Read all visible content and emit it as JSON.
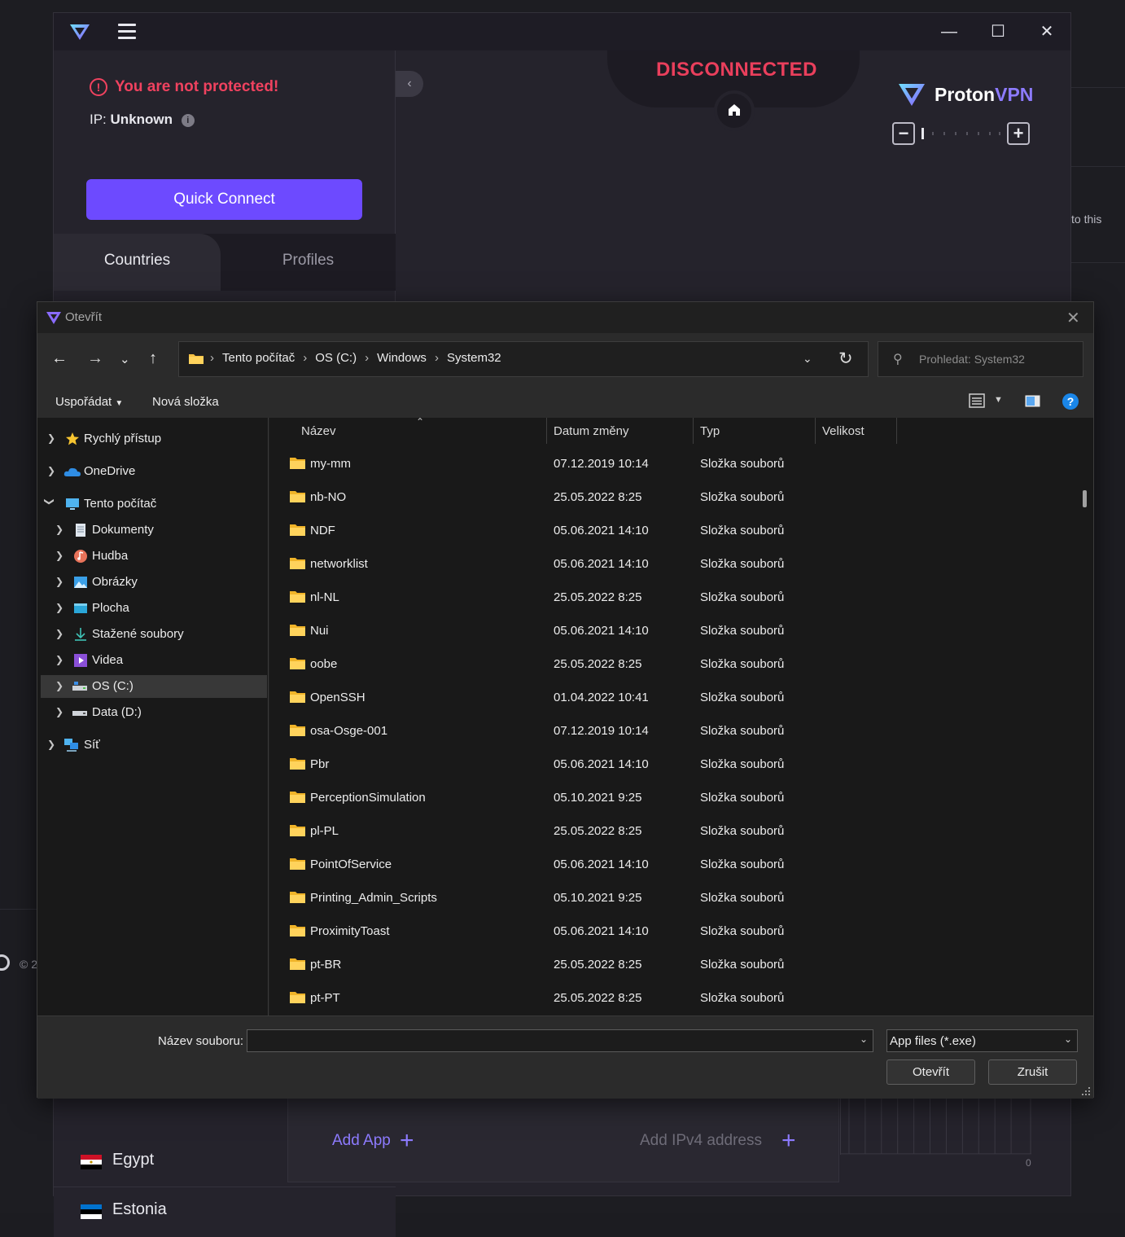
{
  "background": {
    "right_text": "to this",
    "footer_text": "© 2"
  },
  "vpn": {
    "warning": "You are not protected!",
    "ip_label": "IP:",
    "ip_value": "Unknown",
    "quick_connect": "Quick Connect",
    "tabs": [
      "Countries",
      "Profiles"
    ],
    "status": "DISCONNECTED",
    "brand_proton": "Proton",
    "brand_vpn": "VPN",
    "countries": [
      {
        "name": "Egypt"
      },
      {
        "name": "Estonia"
      }
    ],
    "add_app": "Add App",
    "add_ip": "Add IPv4 address",
    "chart_zero": "0",
    "colors": {
      "accent": "#6d4aff",
      "danger": "#ea3f5c"
    }
  },
  "dialog": {
    "title": "Otevřít",
    "breadcrumb": [
      "Tento počítač",
      "OS (C:)",
      "Windows",
      "System32"
    ],
    "search_placeholder": "Prohledat: System32",
    "organize": "Uspořádat",
    "new_folder": "Nová složka",
    "help": "?",
    "nav_tree": [
      {
        "label": "Rychlý přístup",
        "icon": "star-icon"
      },
      {
        "label": "OneDrive",
        "icon": "cloud-icon"
      },
      {
        "label": "Tento počítač",
        "icon": "computer-icon"
      },
      {
        "label": "Dokumenty",
        "icon": "document-icon"
      },
      {
        "label": "Hudba",
        "icon": "music-icon"
      },
      {
        "label": "Obrázky",
        "icon": "pictures-icon"
      },
      {
        "label": "Plocha",
        "icon": "desktop-icon"
      },
      {
        "label": "Stažené soubory",
        "icon": "download-icon"
      },
      {
        "label": "Videa",
        "icon": "video-icon"
      },
      {
        "label": "OS (C:)",
        "icon": "drive-icon"
      },
      {
        "label": "Data (D:)",
        "icon": "drive-icon"
      },
      {
        "label": "Síť",
        "icon": "network-icon"
      }
    ],
    "columns": [
      "Název",
      "Datum změny",
      "Typ",
      "Velikost"
    ],
    "files": [
      {
        "name": "my-mm",
        "date": "07.12.2019 10:14",
        "type": "Složka souborů"
      },
      {
        "name": "nb-NO",
        "date": "25.05.2022 8:25",
        "type": "Složka souborů"
      },
      {
        "name": "NDF",
        "date": "05.06.2021 14:10",
        "type": "Složka souborů"
      },
      {
        "name": "networklist",
        "date": "05.06.2021 14:10",
        "type": "Složka souborů"
      },
      {
        "name": "nl-NL",
        "date": "25.05.2022 8:25",
        "type": "Složka souborů"
      },
      {
        "name": "Nui",
        "date": "05.06.2021 14:10",
        "type": "Složka souborů"
      },
      {
        "name": "oobe",
        "date": "25.05.2022 8:25",
        "type": "Složka souborů"
      },
      {
        "name": "OpenSSH",
        "date": "01.04.2022 10:41",
        "type": "Složka souborů"
      },
      {
        "name": "osa-Osge-001",
        "date": "07.12.2019 10:14",
        "type": "Složka souborů"
      },
      {
        "name": "Pbr",
        "date": "05.06.2021 14:10",
        "type": "Složka souborů"
      },
      {
        "name": "PerceptionSimulation",
        "date": "05.10.2021 9:25",
        "type": "Složka souborů"
      },
      {
        "name": "pl-PL",
        "date": "25.05.2022 8:25",
        "type": "Složka souborů"
      },
      {
        "name": "PointOfService",
        "date": "05.06.2021 14:10",
        "type": "Složka souborů"
      },
      {
        "name": "Printing_Admin_Scripts",
        "date": "05.10.2021 9:25",
        "type": "Složka souborů"
      },
      {
        "name": "ProximityToast",
        "date": "05.06.2021 14:10",
        "type": "Složka souborů"
      },
      {
        "name": "pt-BR",
        "date": "25.05.2022 8:25",
        "type": "Složka souborů"
      },
      {
        "name": "pt-PT",
        "date": "25.05.2022 8:25",
        "type": "Složka souborů"
      }
    ],
    "filename_label": "Název souboru:",
    "filename_value": "",
    "filter": "App files (*.exe)",
    "open": "Otevřít",
    "cancel": "Zrušit"
  }
}
